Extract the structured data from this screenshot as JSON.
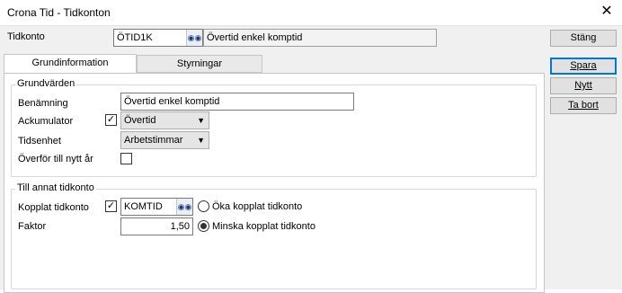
{
  "window": {
    "title": "Crona Tid - Tidkonton"
  },
  "toolbar": {
    "tidkonto_label": "Tidkonto",
    "tidkonto_value": "ÖTID1K",
    "tidkonto_name": "Övertid enkel komptid",
    "close_label": "Stäng"
  },
  "tabs": [
    {
      "label": "Grundinformation"
    },
    {
      "label": "Styrningar"
    }
  ],
  "actions": {
    "save_label": "Spara",
    "new_label": "Nytt",
    "delete_label": "Ta bort"
  },
  "grundvarden": {
    "title": "Grundvärden",
    "benamning_label": "Benämning",
    "benamning_value": "Övertid enkel komptid",
    "ackumulator_label": "Ackumulator",
    "ackumulator_checked": true,
    "ackumulator_value": "Övertid",
    "tidsenhet_label": "Tidsenhet",
    "tidsenhet_value": "Arbetstimmar",
    "overfor_label": "Överför till nytt år",
    "overfor_checked": false
  },
  "till_annat": {
    "title": "Till annat tidkonto",
    "kopplat_label": "Kopplat tidkonto",
    "kopplat_checked": true,
    "kopplat_value": "KOMTID",
    "oka_label": "Öka kopplat tidkonto",
    "minska_label": "Minska kopplat tidkonto",
    "selected": "minska",
    "faktor_label": "Faktor",
    "faktor_value": "1,50"
  },
  "icons": {
    "close": "close-icon",
    "lookup": "binoculars-icon",
    "dropdown": "chevron-down-icon"
  }
}
